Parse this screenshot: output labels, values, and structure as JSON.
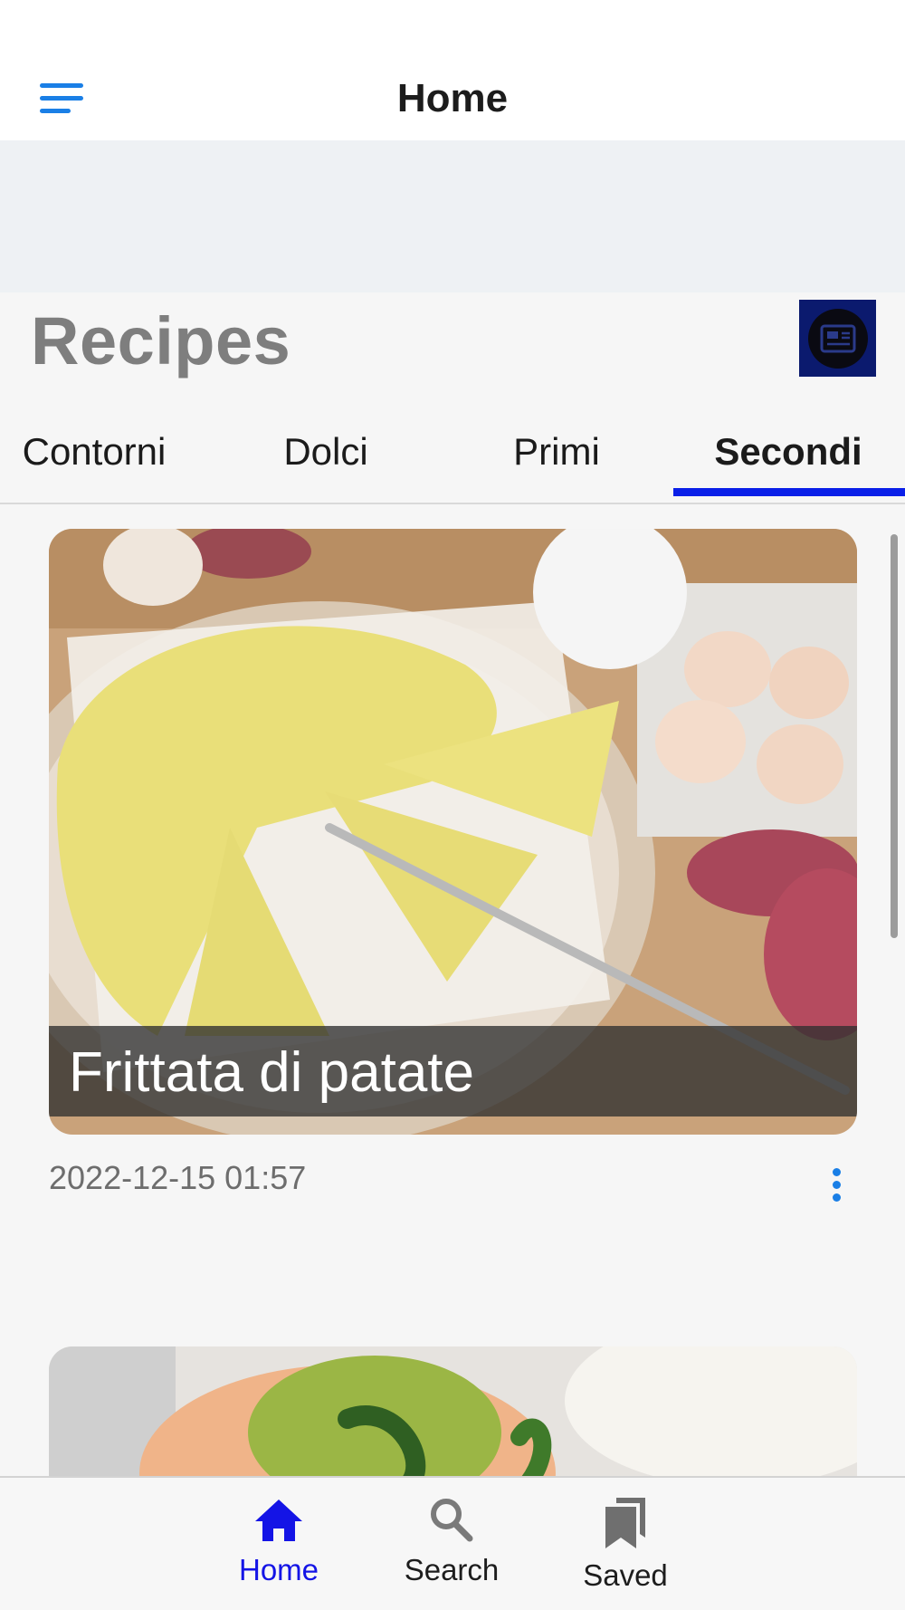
{
  "header": {
    "title": "Home"
  },
  "section": {
    "title": "Recipes"
  },
  "tabs": [
    {
      "label": "Contorni"
    },
    {
      "label": "Dolci"
    },
    {
      "label": "Primi"
    },
    {
      "label": "Secondi",
      "active": true
    }
  ],
  "recipes": [
    {
      "title": "Frittata di patate",
      "date": "2022-12-15 01:57"
    },
    {
      "title": ""
    }
  ],
  "bottom_nav": [
    {
      "label": "Home",
      "icon": "home-icon",
      "active": true
    },
    {
      "label": "Search",
      "icon": "search-icon"
    },
    {
      "label": "Saved",
      "icon": "bookmarks-icon"
    }
  ],
  "colors": {
    "accent": "#1a7fe6",
    "tab_indicator": "#0a1fe8",
    "nav_active": "#1414e6",
    "section_icon_bg": "#0b1a6e"
  }
}
